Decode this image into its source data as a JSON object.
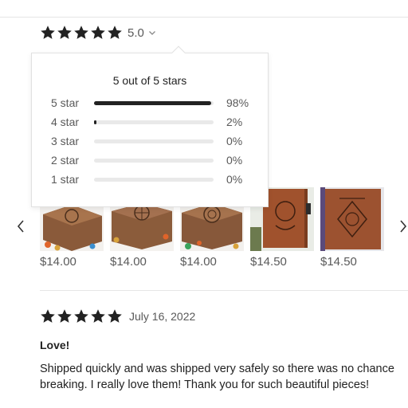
{
  "summary": {
    "stars": 5,
    "score": "5.0"
  },
  "popover": {
    "title": "5 out of 5 stars",
    "rows": [
      {
        "label": "5 star",
        "percent": "98%",
        "value": 98
      },
      {
        "label": "4 star",
        "percent": "2%",
        "value": 2
      },
      {
        "label": "3 star",
        "percent": "0%",
        "value": 0
      },
      {
        "label": "2 star",
        "percent": "0%",
        "value": 0
      },
      {
        "label": "1 star",
        "percent": "0%",
        "value": 0
      }
    ]
  },
  "carousel": {
    "items": [
      {
        "price": "$14.00",
        "image": "dice-box-wood"
      },
      {
        "price": "$14.00",
        "image": "dice-box-compass"
      },
      {
        "price": "$14.00",
        "image": "dice-box-emblem"
      },
      {
        "price": "$14.50",
        "image": "leather-journal-dragon"
      },
      {
        "price": "$14.50",
        "image": "leather-journal-crest"
      }
    ]
  },
  "review": {
    "stars": 5,
    "date": "July 16, 2022",
    "title": "Love!",
    "body_line1": "Shipped quickly and was shipped very safely so there was no chance",
    "body_line2": "breaking. I really love them! Thank you for such beautiful pieces!"
  },
  "colors": {
    "text": "#222222",
    "muted": "#595959",
    "track": "#e9e9e9",
    "wood": "#8a5a3a",
    "leather": "#a0522d"
  },
  "icons": {
    "star": "star-icon",
    "chevron": "chevron-down-icon",
    "prev": "chevron-left-icon",
    "next": "chevron-right-icon"
  }
}
